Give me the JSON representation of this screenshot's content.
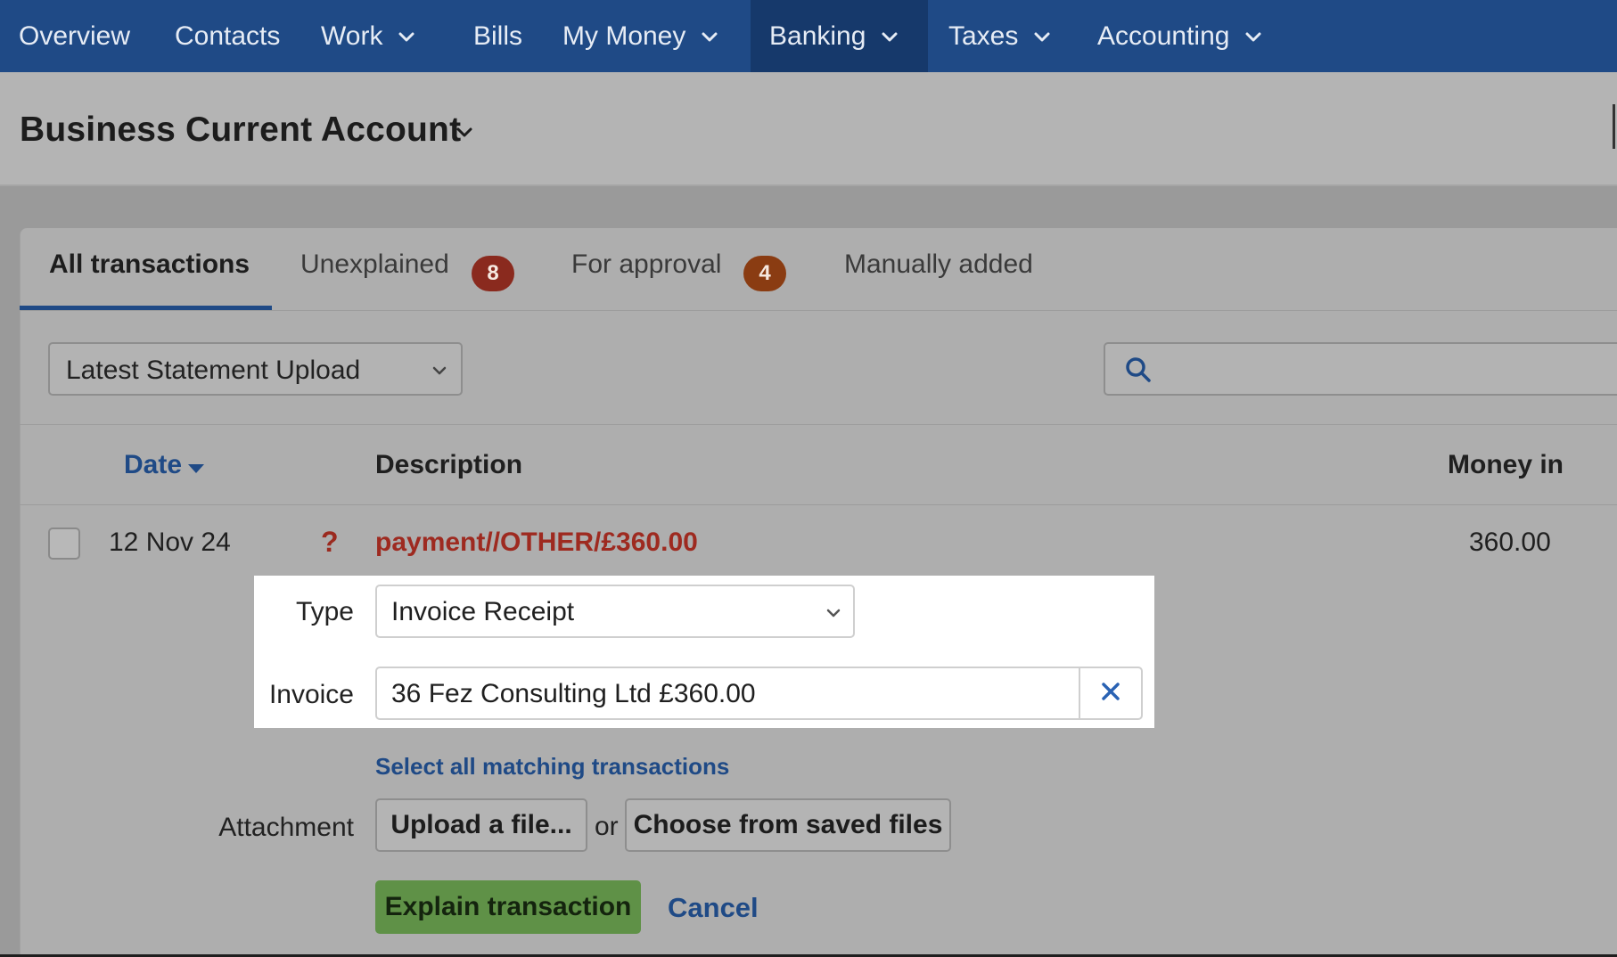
{
  "nav": {
    "items": [
      {
        "label": "Overview",
        "dropdown": false
      },
      {
        "label": "Contacts",
        "dropdown": false
      },
      {
        "label": "Work",
        "dropdown": true
      },
      {
        "label": "Bills",
        "dropdown": false
      },
      {
        "label": "My Money",
        "dropdown": true
      },
      {
        "label": "Banking",
        "dropdown": true,
        "active": true
      },
      {
        "label": "Taxes",
        "dropdown": true
      },
      {
        "label": "Accounting",
        "dropdown": true
      }
    ]
  },
  "header": {
    "title": "Business Current Account"
  },
  "tabs": [
    {
      "label": "All transactions",
      "active": true
    },
    {
      "label": "Unexplained",
      "badge": "8"
    },
    {
      "label": "For approval",
      "badge": "4"
    },
    {
      "label": "Manually added"
    }
  ],
  "filters": {
    "statement_select": "Latest Statement Upload",
    "search_placeholder": ""
  },
  "table": {
    "columns": {
      "date": "Date",
      "description": "Description",
      "money_in": "Money in"
    },
    "row": {
      "date": "12 Nov 24",
      "status_icon": "?",
      "description": "payment//OTHER/£360.00",
      "money_in": "360.00"
    }
  },
  "form": {
    "type_label": "Type",
    "type_value": "Invoice Receipt",
    "invoice_label": "Invoice",
    "invoice_value": "36 Fez Consulting Ltd £360.00",
    "select_matching": "Select all matching transactions",
    "attachment_label": "Attachment",
    "upload_button": "Upload a file...",
    "or_text": "or",
    "choose_button": "Choose from saved files",
    "explain_button": "Explain transaction",
    "cancel_link": "Cancel"
  },
  "colors": {
    "nav_bg": "#1f4a86",
    "badge_unexplained": "#8a2a1e",
    "badge_approval": "#8a3c12",
    "explain_green": "#5f9147",
    "link_blue": "#1f4a86",
    "unexplained_red": "#9e2a20"
  }
}
